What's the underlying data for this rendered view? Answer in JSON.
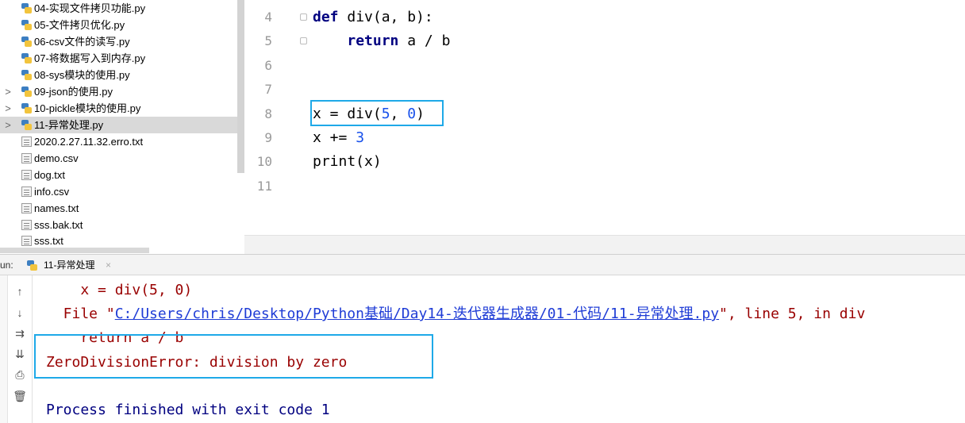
{
  "project_tree": {
    "items": [
      {
        "label": "04-实现文件拷贝功能.py",
        "type": "py",
        "expandable": false
      },
      {
        "label": "05-文件拷贝优化.py",
        "type": "py",
        "expandable": false
      },
      {
        "label": "06-csv文件的读写.py",
        "type": "py",
        "expandable": false
      },
      {
        "label": "07-将数据写入到内存.py",
        "type": "py",
        "expandable": false
      },
      {
        "label": "08-sys模块的使用.py",
        "type": "py",
        "expandable": false
      },
      {
        "label": "09-json的使用.py",
        "type": "py",
        "expandable": true
      },
      {
        "label": "10-pickle模块的使用.py",
        "type": "py",
        "expandable": true
      },
      {
        "label": "11-异常处理.py",
        "type": "py",
        "expandable": true,
        "selected": true
      },
      {
        "label": "2020.2.27.11.32.erro.txt",
        "type": "txt",
        "expandable": false
      },
      {
        "label": "demo.csv",
        "type": "txt",
        "expandable": false
      },
      {
        "label": "dog.txt",
        "type": "txt",
        "expandable": false
      },
      {
        "label": "info.csv",
        "type": "txt",
        "expandable": false
      },
      {
        "label": "names.txt",
        "type": "txt",
        "expandable": false
      },
      {
        "label": "sss.bak.txt",
        "type": "txt",
        "expandable": false
      },
      {
        "label": "sss.txt",
        "type": "txt",
        "expandable": false
      }
    ],
    "expand_glyph": ">"
  },
  "editor": {
    "lines": [
      {
        "n": "4",
        "kw": "def",
        "rest": " div(a, b):"
      },
      {
        "n": "5",
        "indent": "    ",
        "kw": "return",
        "rest": " a / b"
      },
      {
        "n": "6"
      },
      {
        "n": "7"
      },
      {
        "n": "8",
        "pre": "x = div(",
        "num1": "5",
        "mid": ", ",
        "num2": "0",
        "post": ")"
      },
      {
        "n": "9",
        "pre": "x += ",
        "num1": "3"
      },
      {
        "n": "10",
        "pre": "print(x)"
      },
      {
        "n": "11"
      }
    ],
    "highlight_color": "#1ea9e8"
  },
  "run_panel": {
    "label": "un:",
    "tab_label": "11-异常处理",
    "tab_close": "×",
    "toolbar_icons": [
      "arrow-up-icon",
      "arrow-down-icon",
      "soft-wrap-icon",
      "scroll-to-end-icon",
      "print-icon",
      "trash-icon"
    ],
    "output": {
      "line1": "    x = div(5, 0)",
      "line2_prefix": "  File \"",
      "line2_link": "C:/Users/chris/Desktop/Python基础/Day14-迭代器生成器/01-代码/11-异常处理.py",
      "line2_suffix": "\", line 5, in div",
      "line3": "    return a / b",
      "line4": "ZeroDivisionError: division by zero",
      "line6": "Process finished with exit code 1"
    }
  }
}
